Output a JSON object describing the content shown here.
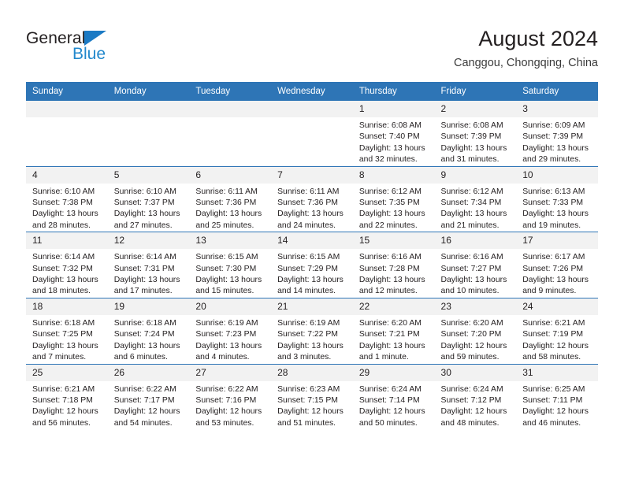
{
  "brand": {
    "logo_line1": "General",
    "logo_line2": "Blue",
    "logo_triangle_color": "#1b7ac4",
    "logo_text_color": "#2288cc"
  },
  "header": {
    "title": "August 2024",
    "subtitle": "Canggou, Chongqing, China"
  },
  "theme": {
    "header_blue": "#2e75b6",
    "daynum_band": "#f2f2f2",
    "text": "#231f20"
  },
  "weekdays": [
    "Sunday",
    "Monday",
    "Tuesday",
    "Wednesday",
    "Thursday",
    "Friday",
    "Saturday"
  ],
  "labels": {
    "sunrise_prefix": "Sunrise: ",
    "sunset_prefix": "Sunset: ",
    "daylight_prefix": "Daylight: "
  },
  "weeks": [
    [
      {
        "day": "",
        "empty": true
      },
      {
        "day": "",
        "empty": true
      },
      {
        "day": "",
        "empty": true
      },
      {
        "day": "",
        "empty": true
      },
      {
        "day": "1",
        "sunrise": "Sunrise: 6:08 AM",
        "sunset": "Sunset: 7:40 PM",
        "daylight": "Daylight: 13 hours and 32 minutes."
      },
      {
        "day": "2",
        "sunrise": "Sunrise: 6:08 AM",
        "sunset": "Sunset: 7:39 PM",
        "daylight": "Daylight: 13 hours and 31 minutes."
      },
      {
        "day": "3",
        "sunrise": "Sunrise: 6:09 AM",
        "sunset": "Sunset: 7:39 PM",
        "daylight": "Daylight: 13 hours and 29 minutes."
      }
    ],
    [
      {
        "day": "4",
        "sunrise": "Sunrise: 6:10 AM",
        "sunset": "Sunset: 7:38 PM",
        "daylight": "Daylight: 13 hours and 28 minutes."
      },
      {
        "day": "5",
        "sunrise": "Sunrise: 6:10 AM",
        "sunset": "Sunset: 7:37 PM",
        "daylight": "Daylight: 13 hours and 27 minutes."
      },
      {
        "day": "6",
        "sunrise": "Sunrise: 6:11 AM",
        "sunset": "Sunset: 7:36 PM",
        "daylight": "Daylight: 13 hours and 25 minutes."
      },
      {
        "day": "7",
        "sunrise": "Sunrise: 6:11 AM",
        "sunset": "Sunset: 7:36 PM",
        "daylight": "Daylight: 13 hours and 24 minutes."
      },
      {
        "day": "8",
        "sunrise": "Sunrise: 6:12 AM",
        "sunset": "Sunset: 7:35 PM",
        "daylight": "Daylight: 13 hours and 22 minutes."
      },
      {
        "day": "9",
        "sunrise": "Sunrise: 6:12 AM",
        "sunset": "Sunset: 7:34 PM",
        "daylight": "Daylight: 13 hours and 21 minutes."
      },
      {
        "day": "10",
        "sunrise": "Sunrise: 6:13 AM",
        "sunset": "Sunset: 7:33 PM",
        "daylight": "Daylight: 13 hours and 19 minutes."
      }
    ],
    [
      {
        "day": "11",
        "sunrise": "Sunrise: 6:14 AM",
        "sunset": "Sunset: 7:32 PM",
        "daylight": "Daylight: 13 hours and 18 minutes."
      },
      {
        "day": "12",
        "sunrise": "Sunrise: 6:14 AM",
        "sunset": "Sunset: 7:31 PM",
        "daylight": "Daylight: 13 hours and 17 minutes."
      },
      {
        "day": "13",
        "sunrise": "Sunrise: 6:15 AM",
        "sunset": "Sunset: 7:30 PM",
        "daylight": "Daylight: 13 hours and 15 minutes."
      },
      {
        "day": "14",
        "sunrise": "Sunrise: 6:15 AM",
        "sunset": "Sunset: 7:29 PM",
        "daylight": "Daylight: 13 hours and 14 minutes."
      },
      {
        "day": "15",
        "sunrise": "Sunrise: 6:16 AM",
        "sunset": "Sunset: 7:28 PM",
        "daylight": "Daylight: 13 hours and 12 minutes."
      },
      {
        "day": "16",
        "sunrise": "Sunrise: 6:16 AM",
        "sunset": "Sunset: 7:27 PM",
        "daylight": "Daylight: 13 hours and 10 minutes."
      },
      {
        "day": "17",
        "sunrise": "Sunrise: 6:17 AM",
        "sunset": "Sunset: 7:26 PM",
        "daylight": "Daylight: 13 hours and 9 minutes."
      }
    ],
    [
      {
        "day": "18",
        "sunrise": "Sunrise: 6:18 AM",
        "sunset": "Sunset: 7:25 PM",
        "daylight": "Daylight: 13 hours and 7 minutes."
      },
      {
        "day": "19",
        "sunrise": "Sunrise: 6:18 AM",
        "sunset": "Sunset: 7:24 PM",
        "daylight": "Daylight: 13 hours and 6 minutes."
      },
      {
        "day": "20",
        "sunrise": "Sunrise: 6:19 AM",
        "sunset": "Sunset: 7:23 PM",
        "daylight": "Daylight: 13 hours and 4 minutes."
      },
      {
        "day": "21",
        "sunrise": "Sunrise: 6:19 AM",
        "sunset": "Sunset: 7:22 PM",
        "daylight": "Daylight: 13 hours and 3 minutes."
      },
      {
        "day": "22",
        "sunrise": "Sunrise: 6:20 AM",
        "sunset": "Sunset: 7:21 PM",
        "daylight": "Daylight: 13 hours and 1 minute."
      },
      {
        "day": "23",
        "sunrise": "Sunrise: 6:20 AM",
        "sunset": "Sunset: 7:20 PM",
        "daylight": "Daylight: 12 hours and 59 minutes."
      },
      {
        "day": "24",
        "sunrise": "Sunrise: 6:21 AM",
        "sunset": "Sunset: 7:19 PM",
        "daylight": "Daylight: 12 hours and 58 minutes."
      }
    ],
    [
      {
        "day": "25",
        "sunrise": "Sunrise: 6:21 AM",
        "sunset": "Sunset: 7:18 PM",
        "daylight": "Daylight: 12 hours and 56 minutes."
      },
      {
        "day": "26",
        "sunrise": "Sunrise: 6:22 AM",
        "sunset": "Sunset: 7:17 PM",
        "daylight": "Daylight: 12 hours and 54 minutes."
      },
      {
        "day": "27",
        "sunrise": "Sunrise: 6:22 AM",
        "sunset": "Sunset: 7:16 PM",
        "daylight": "Daylight: 12 hours and 53 minutes."
      },
      {
        "day": "28",
        "sunrise": "Sunrise: 6:23 AM",
        "sunset": "Sunset: 7:15 PM",
        "daylight": "Daylight: 12 hours and 51 minutes."
      },
      {
        "day": "29",
        "sunrise": "Sunrise: 6:24 AM",
        "sunset": "Sunset: 7:14 PM",
        "daylight": "Daylight: 12 hours and 50 minutes."
      },
      {
        "day": "30",
        "sunrise": "Sunrise: 6:24 AM",
        "sunset": "Sunset: 7:12 PM",
        "daylight": "Daylight: 12 hours and 48 minutes."
      },
      {
        "day": "31",
        "sunrise": "Sunrise: 6:25 AM",
        "sunset": "Sunset: 7:11 PM",
        "daylight": "Daylight: 12 hours and 46 minutes."
      }
    ]
  ]
}
